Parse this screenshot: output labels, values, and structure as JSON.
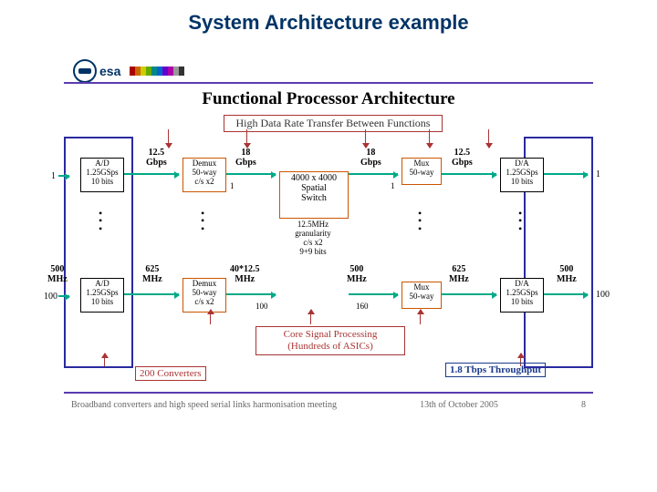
{
  "slide_title": "System Architecture example",
  "logo_text": "esa",
  "diagram_title": "Functional Processor Architecture",
  "subtitle": "High Data Rate Transfer Between Functions",
  "left_inputs": {
    "top": "1",
    "bottom": "100"
  },
  "right_outputs": {
    "top": "1",
    "bottom": "100"
  },
  "ad_block": "A/D\n1.25GSps\n10 bits",
  "demux_block": "Demux\n50-way\nc/s x2",
  "switch_block": "4000 x 4000\nSpatial\nSwitch",
  "switch_note": "12.5MHz\ngranularity\nc/s x2\n9+9 bits",
  "mux_block": "Mux\n50-way",
  "da_block": "D/A\n1.25GSps\n10 bits",
  "rates": {
    "r12_5": "12.5\nGbps",
    "r18": "18\nGbps",
    "r500mhz": "500\nMHz",
    "r625mhz": "625\nMHz",
    "r40x12_5": "40*12.5\nMHz"
  },
  "small_nums": {
    "one": "1",
    "hundred": "100",
    "onesixty": "160"
  },
  "core_note": "Core Signal Processing\n(Hundreds of ASICs)",
  "conv_note": "200 Converters",
  "throughput_note": "1.8 Tbps Throughput",
  "footer_left": "Broadband converters and high speed serial links harmonisation meeting",
  "footer_mid": "13th of October 2005",
  "footer_right": "8"
}
